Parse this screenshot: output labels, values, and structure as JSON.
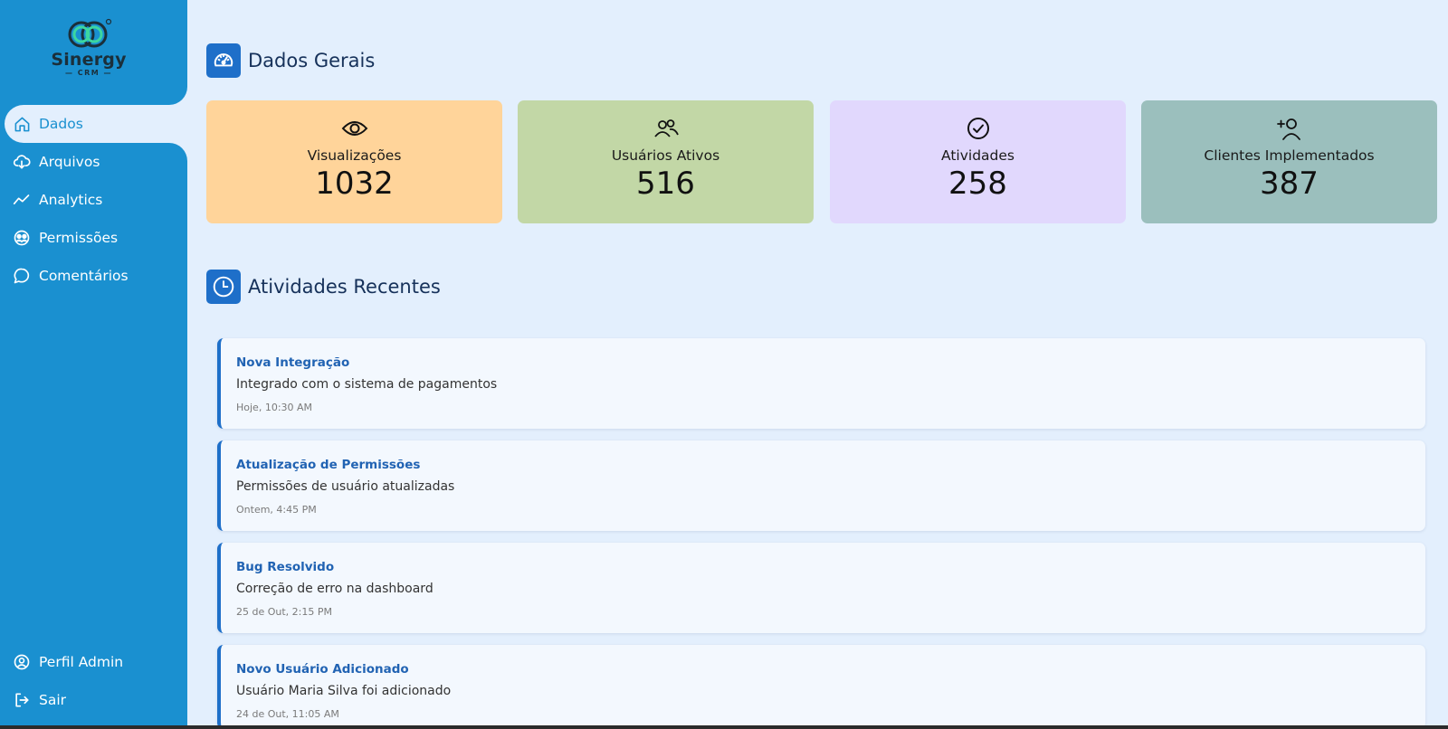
{
  "brand": {
    "name": "Sinergy",
    "sub": "CRM",
    "accent": "#1a90d0"
  },
  "sidebar": {
    "items": [
      {
        "label": "Dados",
        "icon": "home-icon",
        "active": true
      },
      {
        "label": "Arquivos",
        "icon": "cloud-download-icon",
        "active": false
      },
      {
        "label": "Analytics",
        "icon": "trend-line-icon",
        "active": false
      },
      {
        "label": "Permissões",
        "icon": "users-circle-icon",
        "active": false
      },
      {
        "label": "Comentários",
        "icon": "chat-bubble-icon",
        "active": false
      }
    ],
    "bottom": [
      {
        "label": "Perfil Admin",
        "icon": "user-circle-icon"
      },
      {
        "label": "Sair",
        "icon": "logout-icon"
      }
    ]
  },
  "overview": {
    "title": "Dados Gerais",
    "icon": "speedometer-icon",
    "cards": [
      {
        "label": "Visualizações",
        "value": "1032",
        "icon": "eye-icon",
        "color": "#ffd49a"
      },
      {
        "label": "Usuários Ativos",
        "value": "516",
        "icon": "users-icon",
        "color": "#c2d7a6"
      },
      {
        "label": "Atividades",
        "value": "258",
        "icon": "check-circle-icon",
        "color": "#e1d8fd"
      },
      {
        "label": "Clientes Implementados",
        "value": "387",
        "icon": "user-plus-icon",
        "color": "#9bbfbd"
      }
    ]
  },
  "recent": {
    "title": "Atividades Recentes",
    "icon": "clock-icon",
    "items": [
      {
        "title": "Nova Integração",
        "description": "Integrado com o sistema de pagamentos",
        "time": "Hoje, 10:30 AM"
      },
      {
        "title": "Atualização de Permissões",
        "description": "Permissões de usuário atualizadas",
        "time": "Ontem, 4:45 PM"
      },
      {
        "title": "Bug Resolvido",
        "description": "Correção de erro na dashboard",
        "time": "25 de Out, 2:15 PM"
      },
      {
        "title": "Novo Usuário Adicionado",
        "description": "Usuário Maria Silva foi adicionado",
        "time": "24 de Out, 11:05 AM"
      }
    ]
  }
}
